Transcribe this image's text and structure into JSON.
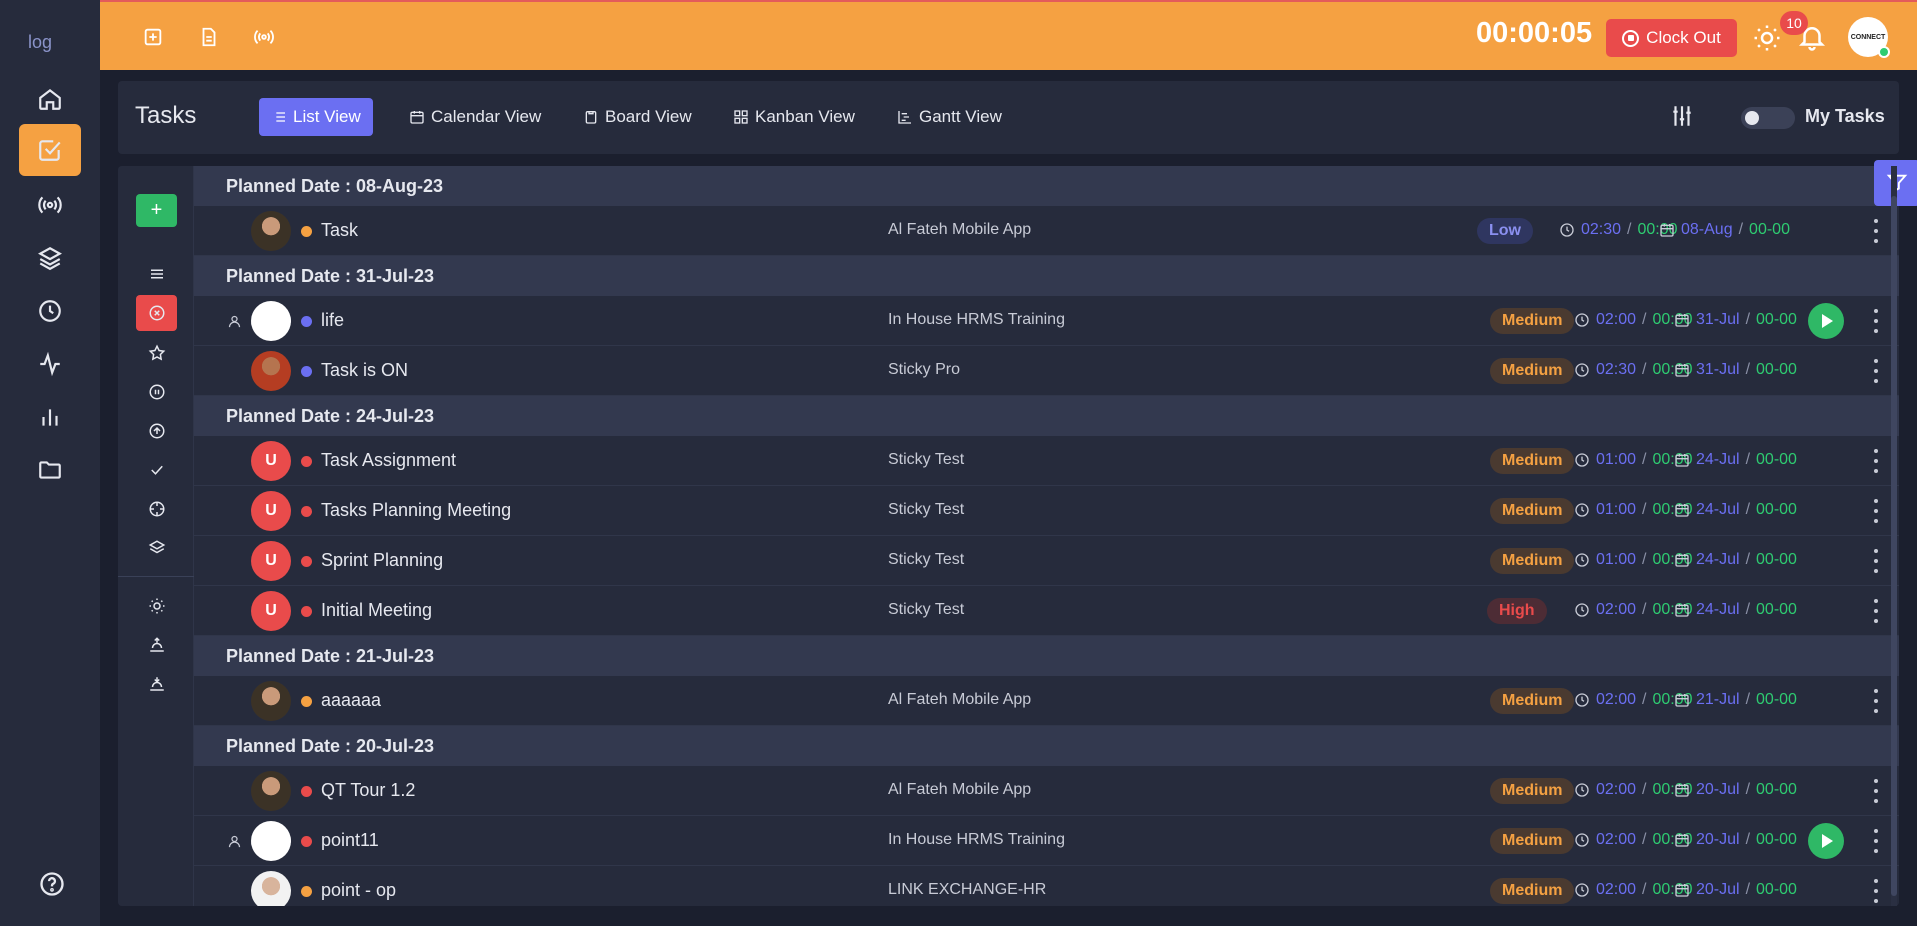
{
  "app": {
    "logo_alt": "log"
  },
  "topbar": {
    "timer": "00:00:05",
    "clock_out_label": "Clock Out",
    "notifications_count": "10",
    "profile_avatar_text": "CONNECT"
  },
  "header": {
    "title": "Tasks",
    "views": [
      "List View",
      "Calendar View",
      "Board View",
      "Kanban View",
      "Gantt View"
    ],
    "active_view": "List View",
    "my_tasks_label": "My Tasks",
    "my_tasks_enabled": false
  },
  "sidebar_icons": [
    "home-icon",
    "tasks-icon",
    "broadcast-icon",
    "layers-icon",
    "clock-icon",
    "activity-icon",
    "bar-chart-icon",
    "folder-icon",
    "help-icon"
  ],
  "status_filters": [
    "list-icon",
    "cancelled-icon",
    "star-icon",
    "pause-icon",
    "upload-circle-icon",
    "check-icon",
    "crosshair-icon",
    "layers-icon",
    "sun-icon",
    "sunrise-icon",
    "sunset-icon"
  ],
  "colors": {
    "accent": "#f5a142",
    "primary": "#6b6ff2",
    "danger": "#e94b4b",
    "success": "#2fb866"
  },
  "groups": [
    {
      "label": "Planned Date : 08-Aug-23",
      "tasks": [
        {
          "name": "Task",
          "project": "Al Fateh Mobile App",
          "priority": "Low",
          "time_est": "02:30",
          "time_spent": "00:00",
          "date": "08-Aug",
          "date2": "00-00",
          "dot": "#f5a142",
          "avatar": "photo",
          "assigned_icon": false,
          "play": false
        }
      ]
    },
    {
      "label": "Planned Date : 31-Jul-23",
      "tasks": [
        {
          "name": "life",
          "project": "In House HRMS Training",
          "priority": "Medium",
          "time_est": "02:00",
          "time_spent": "00:00",
          "date": "31-Jul",
          "date2": "00-00",
          "dot": "#6b6ff2",
          "avatar": "logo",
          "assigned_icon": true,
          "play": true
        },
        {
          "name": "Task is ON",
          "project": "Sticky Pro",
          "priority": "Medium",
          "time_est": "02:30",
          "time_spent": "00:00",
          "date": "31-Jul",
          "date2": "00-00",
          "dot": "#6b6ff2",
          "avatar": "photo2",
          "assigned_icon": false,
          "play": false
        }
      ]
    },
    {
      "label": "Planned Date : 24-Jul-23",
      "tasks": [
        {
          "name": "Task Assignment",
          "project": "Sticky Test",
          "priority": "Medium",
          "time_est": "01:00",
          "time_spent": "00:00",
          "date": "24-Jul",
          "date2": "00-00",
          "dot": "#e94b4b",
          "avatar": "U",
          "assigned_icon": false,
          "play": false
        },
        {
          "name": "Tasks Planning Meeting",
          "project": "Sticky Test",
          "priority": "Medium",
          "time_est": "01:00",
          "time_spent": "00:00",
          "date": "24-Jul",
          "date2": "00-00",
          "dot": "#e94b4b",
          "avatar": "U",
          "assigned_icon": false,
          "play": false
        },
        {
          "name": "Sprint Planning",
          "project": "Sticky Test",
          "priority": "Medium",
          "time_est": "01:00",
          "time_spent": "00:00",
          "date": "24-Jul",
          "date2": "00-00",
          "dot": "#e94b4b",
          "avatar": "U",
          "assigned_icon": false,
          "play": false
        },
        {
          "name": "Initial Meeting",
          "project": "Sticky Test",
          "priority": "High",
          "time_est": "02:00",
          "time_spent": "00:00",
          "date": "24-Jul",
          "date2": "00-00",
          "dot": "#e94b4b",
          "avatar": "U",
          "assigned_icon": false,
          "play": false
        }
      ]
    },
    {
      "label": "Planned Date : 21-Jul-23",
      "tasks": [
        {
          "name": "aaaaaa",
          "project": "Al Fateh Mobile App",
          "priority": "Medium",
          "time_est": "02:00",
          "time_spent": "00:00",
          "date": "21-Jul",
          "date2": "00-00",
          "dot": "#f5a142",
          "avatar": "photo",
          "assigned_icon": false,
          "play": false
        }
      ]
    },
    {
      "label": "Planned Date : 20-Jul-23",
      "tasks": [
        {
          "name": "QT Tour 1.2",
          "project": "Al Fateh Mobile App",
          "priority": "Medium",
          "time_est": "02:00",
          "time_spent": "00:00",
          "date": "20-Jul",
          "date2": "00-00",
          "dot": "#e94b4b",
          "avatar": "photo",
          "assigned_icon": false,
          "play": false
        },
        {
          "name": "point11",
          "project": "In House HRMS Training",
          "priority": "Medium",
          "time_est": "02:00",
          "time_spent": "00:00",
          "date": "20-Jul",
          "date2": "00-00",
          "dot": "#e94b4b",
          "avatar": "logo",
          "assigned_icon": true,
          "play": true
        },
        {
          "name": "point - op",
          "project": "LINK EXCHANGE-HR",
          "priority": "Medium",
          "time_est": "02:00",
          "time_spent": "00:00",
          "date": "20-Jul",
          "date2": "00-00",
          "dot": "#f5a142",
          "avatar": "photo3",
          "assigned_icon": false,
          "play": false
        }
      ]
    }
  ]
}
